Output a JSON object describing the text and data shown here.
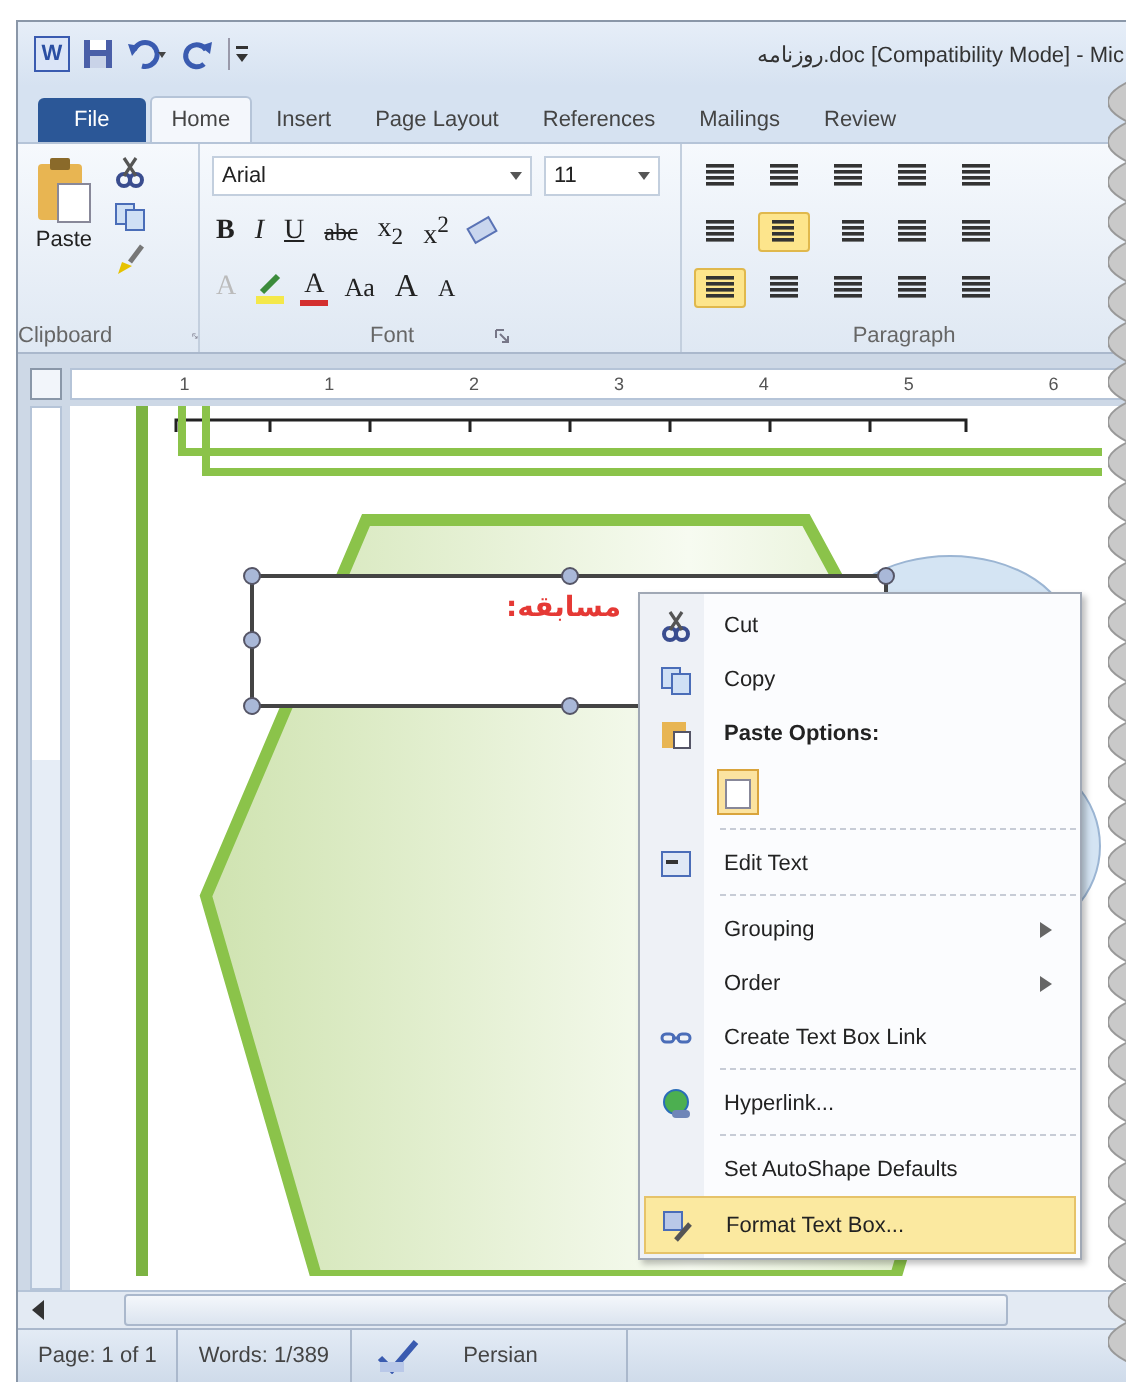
{
  "window": {
    "title": "روزنامه.doc [Compatibility Mode] - Mic",
    "app_letter": "W"
  },
  "tabs": [
    {
      "label": "File",
      "kind": "file",
      "selected": false
    },
    {
      "label": "Home",
      "kind": "tab",
      "selected": true
    },
    {
      "label": "Insert",
      "kind": "tab",
      "selected": false
    },
    {
      "label": "Page Layout",
      "kind": "tab",
      "selected": false
    },
    {
      "label": "References",
      "kind": "tab",
      "selected": false
    },
    {
      "label": "Mailings",
      "kind": "tab",
      "selected": false
    },
    {
      "label": "Review",
      "kind": "tab",
      "selected": false
    }
  ],
  "ribbon": {
    "clipboard": {
      "label": "Clipboard",
      "paste": "Paste"
    },
    "font": {
      "label": "Font",
      "font_name": "Arial",
      "font_size": "11",
      "row_2": [
        {
          "label": "B",
          "kind": "bold"
        },
        {
          "label": "I",
          "kind": "italic"
        },
        {
          "label": "U",
          "kind": "underline"
        },
        {
          "label": "abc",
          "kind": "strike"
        },
        {
          "label": "x$_{2}$",
          "kind": "plain"
        },
        {
          "label": "x$^{2}$",
          "kind": "plain"
        }
      ],
      "row_3": [
        {
          "label": "A",
          "kind": "effects"
        },
        {
          "label": "A",
          "kind": "color"
        },
        {
          "label": "Aa",
          "kind": "case"
        },
        {
          "label": "A",
          "kind": "grow"
        },
        {
          "label": "A",
          "kind": "shrink"
        }
      ]
    },
    "paragraph": {
      "label": "Paragraph",
      "rows": [
        [
          {
            "selected": false
          },
          {
            "selected": false
          },
          {
            "selected": false
          },
          {
            "selected": false
          },
          {
            "selected": false
          }
        ],
        [
          {
            "selected": false
          },
          {
            "selected": true
          },
          {
            "selected": false
          },
          {
            "selected": false
          },
          {
            "selected": false
          }
        ],
        [
          {
            "selected": true
          },
          {
            "selected": false
          },
          {
            "selected": false
          },
          {
            "selected": false
          },
          {
            "selected": false
          }
        ]
      ]
    }
  },
  "ruler": {
    "numbers": [
      "1",
      "1",
      "2",
      "3",
      "4",
      "5",
      "6"
    ]
  },
  "document": {
    "text_box": {
      "text": "مسابقه:"
    }
  },
  "context_menu": [
    {
      "label": "Cut",
      "kind": "command",
      "submenu": false,
      "separated": false,
      "selected": false
    },
    {
      "label": "Copy",
      "kind": "command",
      "submenu": false,
      "separated": false,
      "selected": false
    },
    {
      "label": "Paste Options:",
      "kind": "heading",
      "submenu": false,
      "separated": false,
      "selected": false
    },
    {
      "label": "Edit Text",
      "kind": "command",
      "submenu": false,
      "separated": true,
      "selected": false
    },
    {
      "label": "Grouping",
      "kind": "command",
      "submenu": true,
      "separated": true,
      "selected": false
    },
    {
      "label": "Order",
      "kind": "command",
      "submenu": true,
      "separated": false,
      "selected": false
    },
    {
      "label": "Create Text Box Link",
      "kind": "command",
      "submenu": false,
      "separated": false,
      "selected": false
    },
    {
      "label": "Hyperlink...",
      "kind": "command",
      "submenu": false,
      "separated": true,
      "selected": false
    },
    {
      "label": "Set AutoShape Defaults",
      "kind": "command",
      "submenu": false,
      "separated": true,
      "selected": false
    },
    {
      "label": "Format Text Box...",
      "kind": "command",
      "submenu": false,
      "separated": false,
      "selected": true
    }
  ],
  "status_bar": {
    "page": "Page: 1 of 1",
    "words": "Words: 1/389",
    "language": "Persian"
  }
}
